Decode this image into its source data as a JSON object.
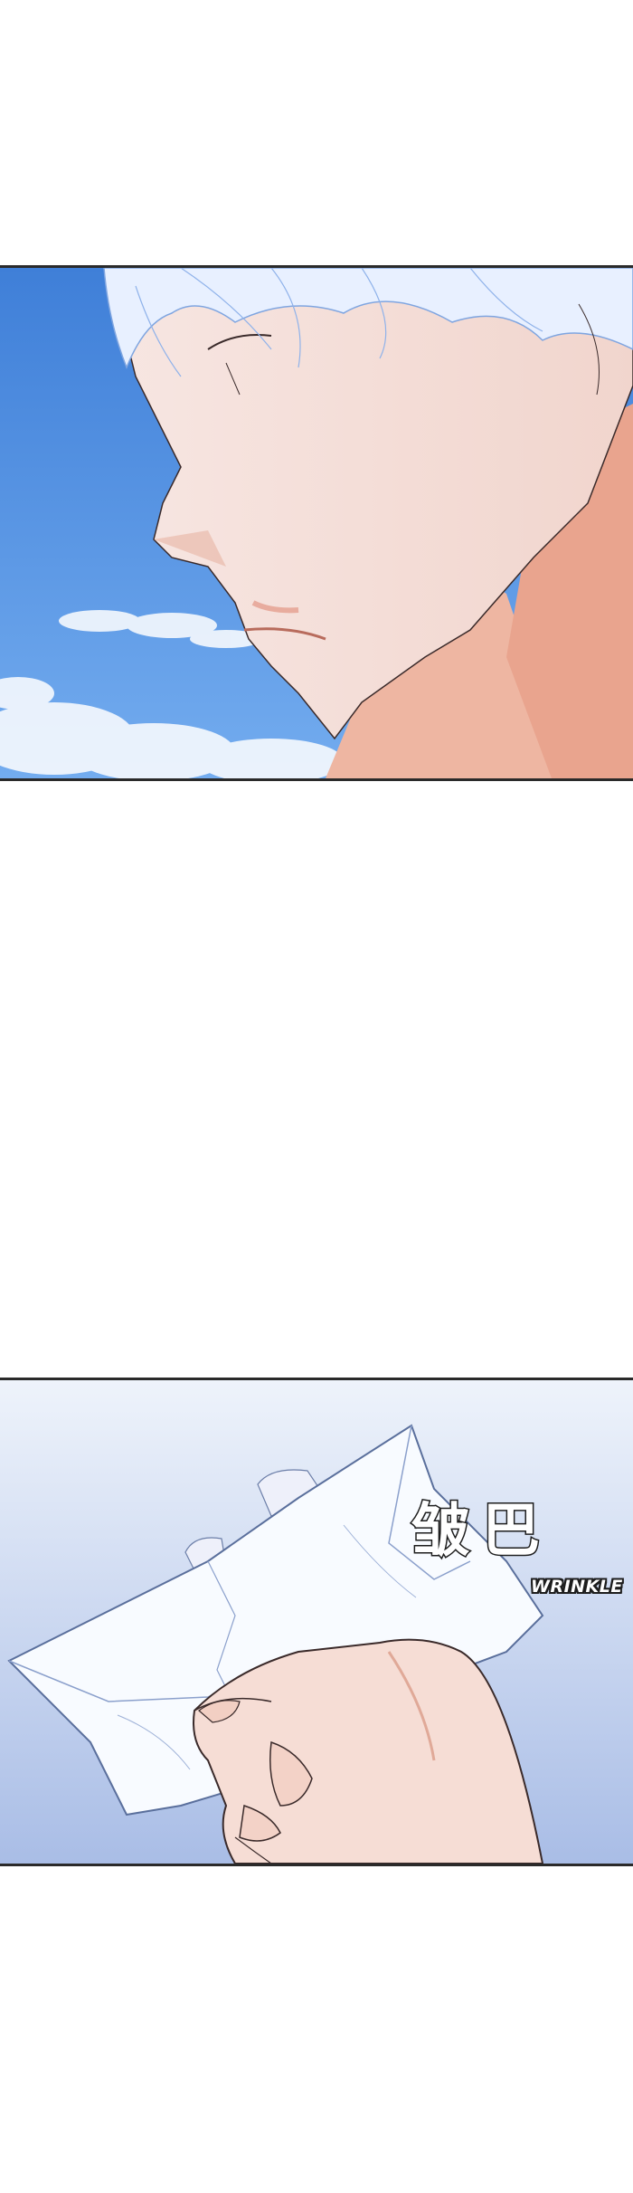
{
  "sfx": {
    "main": "皱巴",
    "sub": "WRINKLE"
  },
  "colors": {
    "sky_top": "#3f7fd8",
    "sky_bottom": "#6aa6ee",
    "skin": "#f4ddd6",
    "skin_shadow": "#e9a48e",
    "hair": "#e8f0ff",
    "pale_sky_top": "#eef3fb",
    "pale_sky_bottom": "#a9bde6",
    "paper": "#f8fbff",
    "border": "#2a2a2a"
  }
}
